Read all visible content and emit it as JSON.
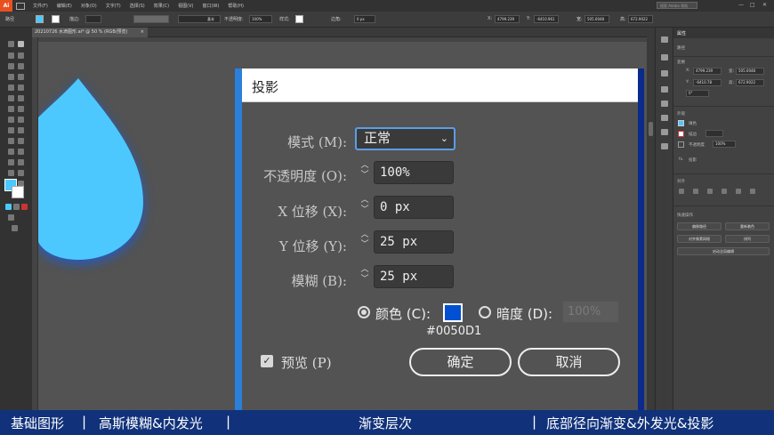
{
  "menubar": {
    "logo": "Ai",
    "items": [
      "文件(F)",
      "编辑(E)",
      "对象(O)",
      "文字(T)",
      "选择(S)",
      "效果(C)",
      "视图(V)",
      "窗口(W)",
      "帮助(H)"
    ],
    "search_placeholder": "搜索 Adobe 帮助"
  },
  "control_bar": {
    "selection_label": "路径",
    "stroke_label": "描边:",
    "stroke_style": "基本",
    "opacity_label": "不透明度:",
    "opacity_value": "100%",
    "style_label": "样式:",
    "corner_label": "边角:",
    "corner_value": "0 px",
    "x_label": "X:",
    "x_value": "4799.239",
    "y_label": "Y:",
    "y_value": "-6410.961",
    "w_label": "宽:",
    "w_value": "505.0048",
    "h_label": "高:",
    "h_value": "672.9022"
  },
  "document": {
    "tab_title": "20210726 水滴图形.ai* @ 50 % (RGB/预览)",
    "tab_close": "×"
  },
  "right_panel": {
    "tabs": [
      "属性"
    ],
    "selection": "路径",
    "transform_title": "变换",
    "x": "4799.239",
    "y": "-6410.78",
    "w": "505.0048",
    "h": "672.9022",
    "angle": "0°",
    "appearance_title": "外观",
    "fill_label": "填色",
    "stroke_label": "描边",
    "opacity_label": "不透明度",
    "opacity_value": "100%",
    "fx_label": "投影",
    "align_title": "对齐",
    "quick_actions_title": "快速操作",
    "qa_buttons": [
      "偏移路径",
      "重新着色",
      "对齐像素网格",
      "排列"
    ],
    "qa_wide": "启动全局编辑"
  },
  "dialog": {
    "title": "投影",
    "mode_label": "模式 (M):",
    "mode_value": "正常",
    "opacity_label": "不透明度 (O):",
    "opacity_value": "100%",
    "x_label": "X 位移 (X):",
    "x_value": "0 px",
    "y_label": "Y 位移 (Y):",
    "y_value": "25 px",
    "blur_label": "模糊 (B):",
    "blur_value": "25 px",
    "color_label": "颜色 (C):",
    "color_hex": "#0050D1",
    "darkness_label": "暗度 (D):",
    "darkness_value": "100%",
    "preview_label": "预览 (P)",
    "ok_label": "确定",
    "cancel_label": "取消"
  },
  "bottom_bar": {
    "items": [
      "基础图形",
      "高斯模糊&内发光",
      "渐变层次",
      "底部径向渐变&外发光&投影"
    ],
    "separator": "|"
  },
  "colors": {
    "drop_fill": "#4DC8FF",
    "shadow_color": "#0050D1",
    "bottom_bar": "#11327a",
    "accent": "#5a9ee6"
  }
}
